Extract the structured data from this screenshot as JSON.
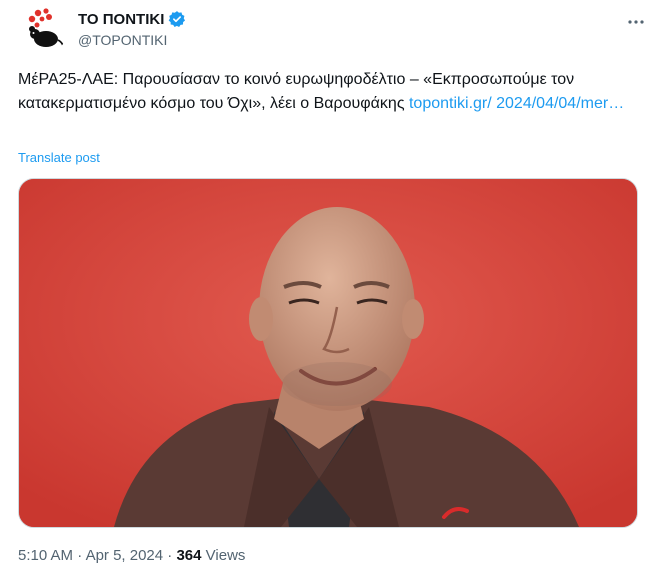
{
  "author": {
    "display_name": "ΤΟ ΠΟΝΤΙΚΙ",
    "handle": "@TOPONTIKI",
    "verified": true
  },
  "tweet": {
    "text_before_link": "ΜέΡΑ25-ΛΑΕ: Παρουσίασαν το κοινό ευρωψηφοδέλτιο – «Εκπροσωπούμε τον κατακερματισμένο κόσμο του Όχι», λέει ο Βαρουφάκης ",
    "link_text": "topontiki.gr/ 2024/04/04/mer…",
    "translate_label": "Translate post"
  },
  "meta": {
    "time": "5:10 AM",
    "separator": "·",
    "date": "Apr 5, 2024",
    "views_count": "364",
    "views_label": "Views"
  },
  "colors": {
    "link": "#1d9bf0",
    "verified": "#1d9bf0",
    "media_background": "#d8463f"
  },
  "icons": {
    "verified": "verified-badge-icon",
    "more": "more-options-icon"
  }
}
